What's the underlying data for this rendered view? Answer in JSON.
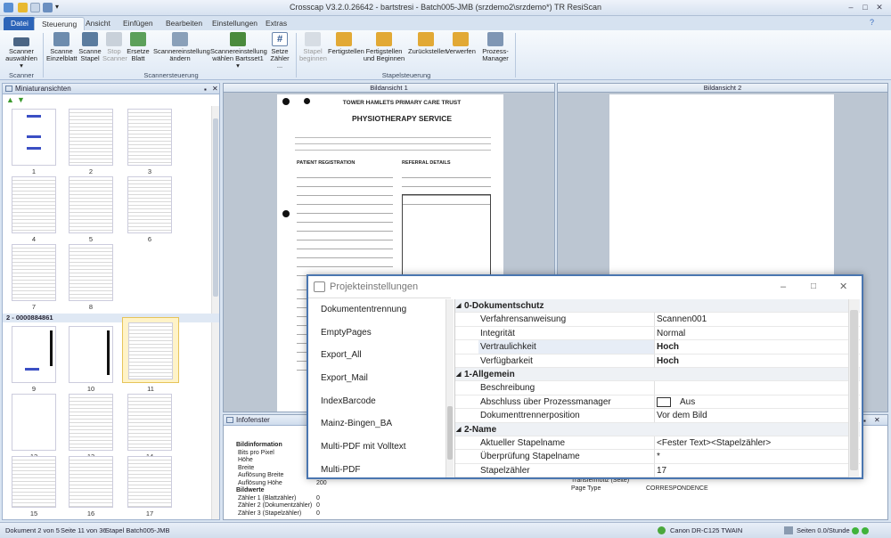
{
  "window": {
    "title": "Crosscap V3.2.0.26642 - bartstresi - Batch005-JMB (srzdemo2\\srzdemo*) TR ResiScan",
    "controls": [
      "–",
      "□",
      "✕"
    ]
  },
  "tabs": [
    {
      "label": "Datei"
    },
    {
      "label": "Steuerung"
    },
    {
      "label": "Ansicht"
    },
    {
      "label": "Einfügen"
    },
    {
      "label": "Bearbeiten"
    },
    {
      "label": "Einstellungen"
    },
    {
      "label": "Extras"
    }
  ],
  "ribbon": {
    "scanner_group": "Scanner",
    "scanner_select": "Scanner auswählen ▾",
    "scan_single": "Scanne Einzelblatt",
    "scan_batch": "Scanne Stapel",
    "stop_scanner": "Stop Scanner",
    "replace_sheet": "Ersetze Blatt",
    "scanner_settings": "Scannereinstellung ändern",
    "scanner_settings_batch": "Scannereinstellung wählen Bartsset1 ▾",
    "set_counter": "Setze Zähler ...",
    "scanner_control_group": "Scannersteuerung",
    "start_batch": "Stapel beginnen",
    "finish": "Fertigstellen",
    "finish_and_start": "Fertigstellen und Beginnen",
    "reset": "Zurückstellen",
    "discard": "Verwerfen",
    "process_manager": "Prozess-Manager",
    "batch_control_group": "Stapelsteuerung"
  },
  "left_pane": {
    "title": "Miniaturansichten",
    "batch1_thumbs": [
      "1",
      "2",
      "3",
      "4",
      "5",
      "6",
      "7",
      "8"
    ],
    "batch2_label": "2 - 0000884861",
    "batch2_thumbs": [
      "9",
      "10",
      "11",
      "12",
      "13",
      "14",
      "15",
      "16",
      "17"
    ]
  },
  "viewer1": {
    "title": "Bildansicht 1",
    "doc_heading1": "TOWER HAMLETS PRIMARY CARE TRUST",
    "doc_heading2": "PHYSIOTHERAPY SERVICE",
    "patient_reg": "PATIENT REGISTRATION",
    "referral": "REFERRAL DETAILS"
  },
  "viewer2": {
    "title": "Bildansicht 2"
  },
  "info": {
    "title": "Infofenster",
    "section1": "Bildinformation",
    "rows": [
      {
        "k": "Bits pro Pixel",
        "v": ""
      },
      {
        "k": "Höhe",
        "v": ""
      },
      {
        "k": "Breite",
        "v": ""
      },
      {
        "k": "Auflösung Breite",
        "v": "200"
      },
      {
        "k": "Auflösung Höhe",
        "v": "200"
      }
    ],
    "section2": "Bildwerte",
    "rows2": [
      {
        "k": "Zähler 1 (Blattzähler)",
        "v": "0"
      },
      {
        "k": "Zähler 2 (Dokumentzähler)",
        "v": "0"
      },
      {
        "k": "Zähler 3 (Stapelzähler)",
        "v": "0"
      }
    ],
    "right_rows": [
      {
        "k": "Transfermotiz (Seite)",
        "v": ""
      },
      {
        "k": "Page Type",
        "v": "CORRESPONDENCE"
      }
    ]
  },
  "status": {
    "document": "Dokument 2 von 5",
    "page": "Seite 11 von 36",
    "batch": "Stapel Batch005-JMB",
    "scanner": "Canon DR-C125 TWAIN",
    "speed": "Seiten 0.0/Stunde"
  },
  "dialog": {
    "title": "Projekteinstellungen",
    "list": [
      "Dokumententrennung",
      "EmptyPages",
      "Export_All",
      "Export_Mail",
      "IndexBarcode",
      "Mainz-Bingen_BA",
      "Multi-PDF mit Volltext",
      "Multi-PDF"
    ],
    "grid": [
      {
        "type": "cat",
        "k": "0-Dokumentschutz"
      },
      {
        "k": "Verfahrensanweisung",
        "v": "Scannen001"
      },
      {
        "k": "Integrität",
        "v": "Normal"
      },
      {
        "k": "Vertraulichkeit",
        "v": "Hoch",
        "hl": true,
        "bold": true
      },
      {
        "k": "Verfügbarkeit",
        "v": "Hoch",
        "bold": true
      },
      {
        "type": "cat",
        "k": "1-Allgemein"
      },
      {
        "k": "Beschreibung",
        "v": ""
      },
      {
        "k": "Abschluss über Prozessmanager",
        "v": "Aus",
        "checkbox": true
      },
      {
        "k": "Dokumenttrennerposition",
        "v": "Vor dem Bild"
      },
      {
        "type": "cat",
        "k": "2-Name"
      },
      {
        "k": "Aktueller Stapelname",
        "v": "<Fester Text><Stapelzähler>"
      },
      {
        "k": "Überprüfung Stapelname",
        "v": "*"
      },
      {
        "k": "Stapelzähler",
        "v": "17"
      }
    ]
  }
}
